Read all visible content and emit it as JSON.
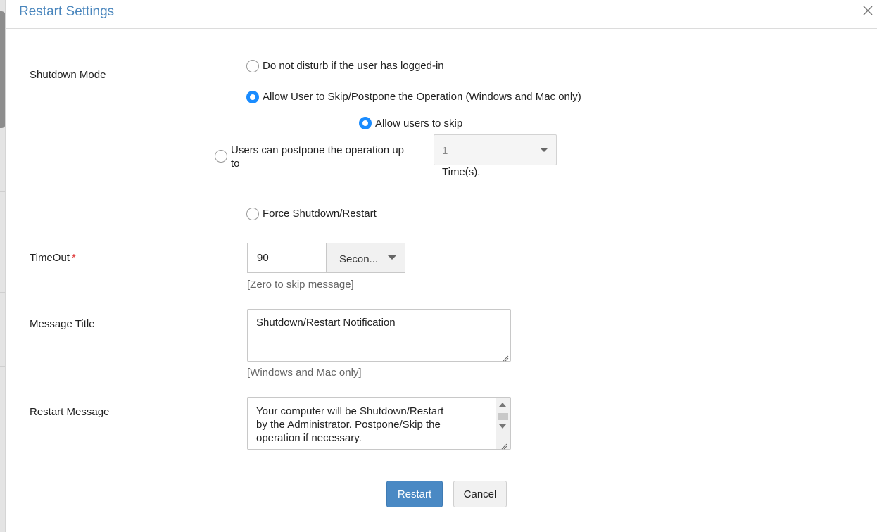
{
  "dialog": {
    "title": "Restart Settings"
  },
  "shutdown_mode": {
    "label": "Shutdown Mode",
    "options": {
      "do_not_disturb": "Do not disturb if the user has logged-in",
      "allow_skip_postpone": "Allow User to Skip/Postpone the Operation (Windows and Mac only)",
      "force": "Force Shutdown/Restart"
    },
    "sub_options": {
      "allow_skip": "Allow users to skip",
      "postpone_line1": "Users can postpone the operation up",
      "postpone_line2": "to"
    },
    "postpone_count": "1",
    "postpone_unit": "Time(s).",
    "selected": "allow_skip_postpone",
    "sub_selected": "allow_skip"
  },
  "timeout": {
    "label": "TimeOut",
    "required_mark": "*",
    "value": "90",
    "unit": "Secon...",
    "hint": "[Zero to skip message]"
  },
  "message_title": {
    "label": "Message Title",
    "value": "Shutdown/Restart Notification",
    "hint": "[Windows and Mac only]"
  },
  "restart_message": {
    "label": "Restart Message",
    "line1": "Your computer will be Shutdown/Restart",
    "line2": "by the Administrator. Postpone/Skip the",
    "line3": "operation if necessary."
  },
  "buttons": {
    "restart": "Restart",
    "cancel": "Cancel"
  },
  "colors": {
    "title": "#4a86bd",
    "radio_checked": "#1a8cff",
    "primary_button": "#4a89c4",
    "required": "#e03a3a"
  }
}
